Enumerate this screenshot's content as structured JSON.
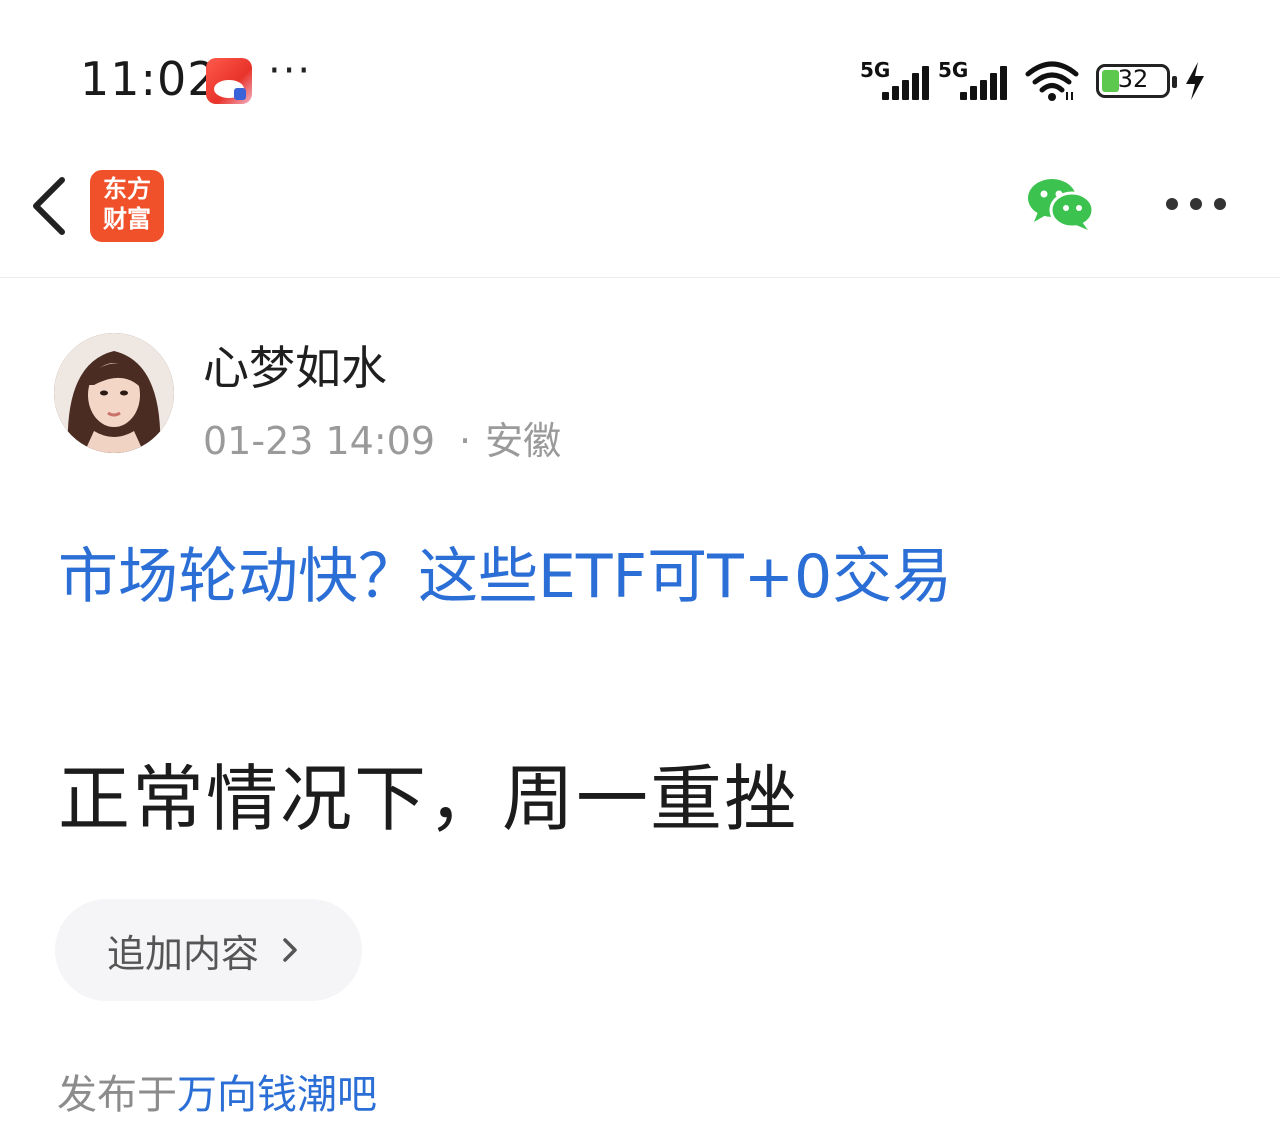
{
  "status_bar": {
    "time": "11:02",
    "notif_more": "···",
    "signal1_label": "5G",
    "signal2_label": "5G",
    "battery_level": "32"
  },
  "nav": {
    "logo_line1": "东方",
    "logo_line2": "财富"
  },
  "post": {
    "author_name": "心梦如水",
    "date": "01-23 14:09",
    "separator": "·",
    "location": "安徽",
    "linked_title": "市场轮动快？这些ETF可T+0交易",
    "body": "正常情况下，周一重挫",
    "add_content_label": "追加内容",
    "published_prefix": "发布于",
    "forum_name": "万向钱潮吧"
  },
  "colors": {
    "link_blue": "#2b6fd6",
    "logo_orange": "#f0502a",
    "wechat_green": "#3cc24f"
  },
  "icons": [
    "back-arrow-icon",
    "app-logo",
    "wechat-share-icon",
    "more-options-icon",
    "wifi-icon",
    "battery-icon",
    "charging-icon",
    "chevron-right-icon"
  ]
}
